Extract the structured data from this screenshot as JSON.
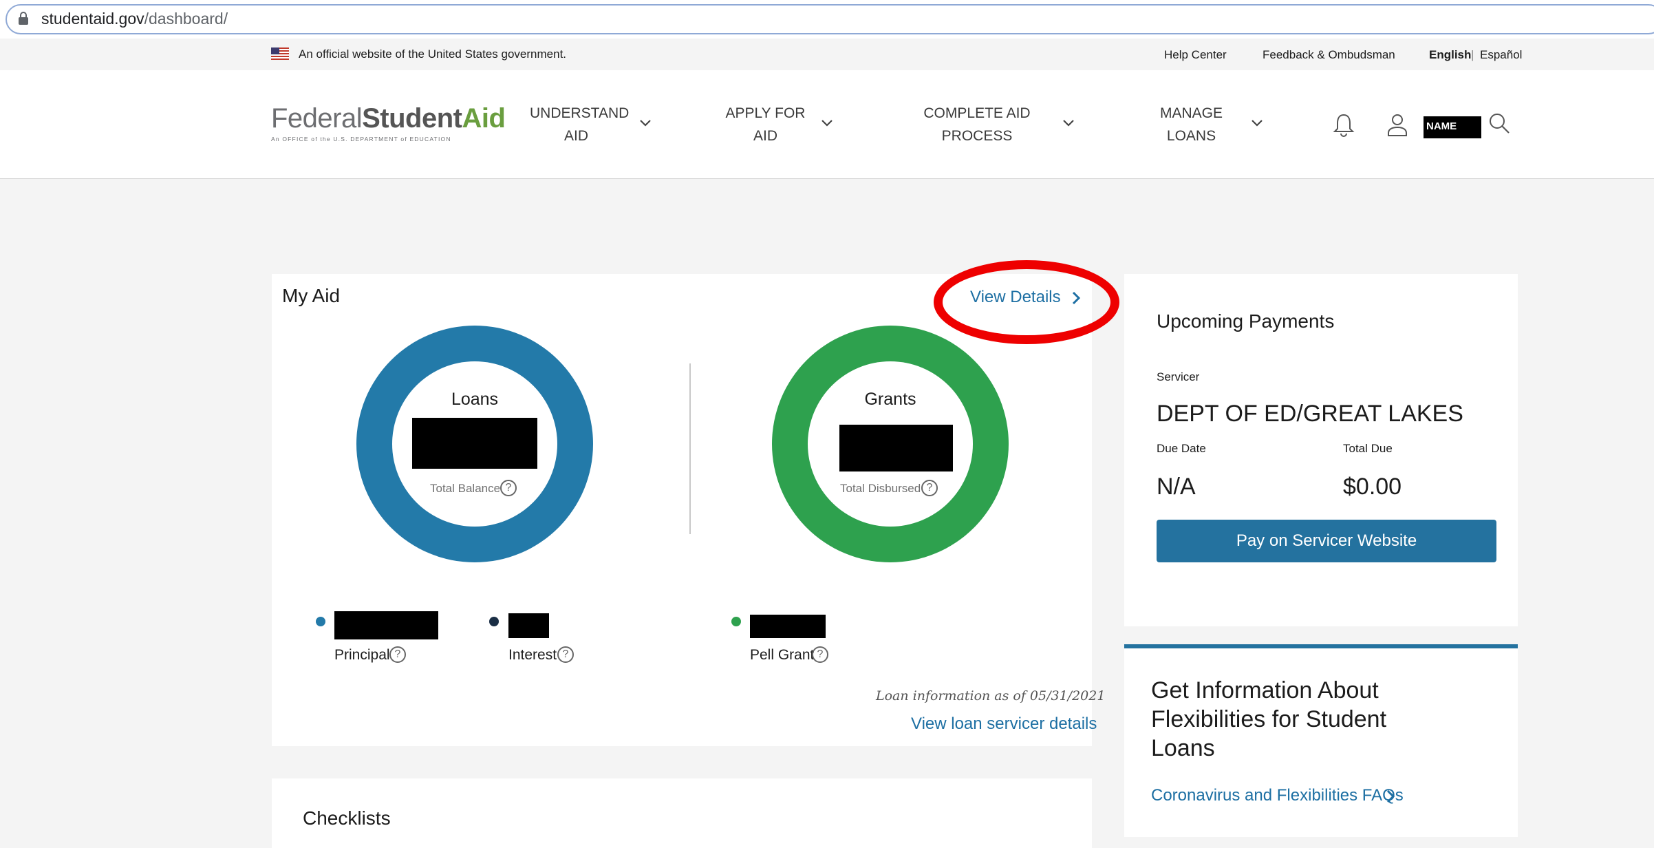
{
  "browser": {
    "url_host": "studentaid.gov",
    "url_path": "/dashboard/"
  },
  "gov_banner": {
    "text": "An official website of the United States government.",
    "help_center": "Help Center",
    "feedback": "Feedback & Ombudsman",
    "lang_en": "English",
    "lang_sep": "|",
    "lang_es": "Español"
  },
  "header": {
    "logo_federal": "Federal",
    "logo_student": "Student",
    "logo_aid": "Aid",
    "logo_sub": "An OFFICE of the U.S. DEPARTMENT of EDUCATION",
    "nav": [
      {
        "line1": "UNDERSTAND",
        "line2": "AID"
      },
      {
        "line1": "APPLY FOR",
        "line2": "AID"
      },
      {
        "line1": "COMPLETE AID",
        "line2": "PROCESS"
      },
      {
        "line1": "MANAGE",
        "line2": "LOANS"
      }
    ],
    "user_name": "NAME"
  },
  "my_aid": {
    "title": "My Aid",
    "view_details": "View Details",
    "loans_label": "Loans",
    "loans_sub": "Total Balance",
    "grants_label": "Grants",
    "grants_sub": "Total Disbursed",
    "principal": "Principal",
    "interest": "Interest",
    "pell_grant": "Pell Grant",
    "as_of": "Loan information as of 05/31/2021",
    "servicer_link": "View loan servicer details"
  },
  "upcoming": {
    "title": "Upcoming Payments",
    "servicer_label": "Servicer",
    "servicer_value": "DEPT OF ED/GREAT LAKES",
    "due_date_label": "Due Date",
    "due_date_value": "N/A",
    "total_due_label": "Total Due",
    "total_due_value": "$0.00",
    "pay_button": "Pay on Servicer Website"
  },
  "info_card": {
    "title": "Get Information About Flexibilities for Student Loans",
    "link": "Coronavirus and Flexibilities FAQs"
  },
  "checklists": {
    "title": "Checklists"
  },
  "colors": {
    "loans": "#237aa9",
    "grants": "#2ea14e",
    "interest": "#1a2e45",
    "link": "#1d6fa3"
  }
}
